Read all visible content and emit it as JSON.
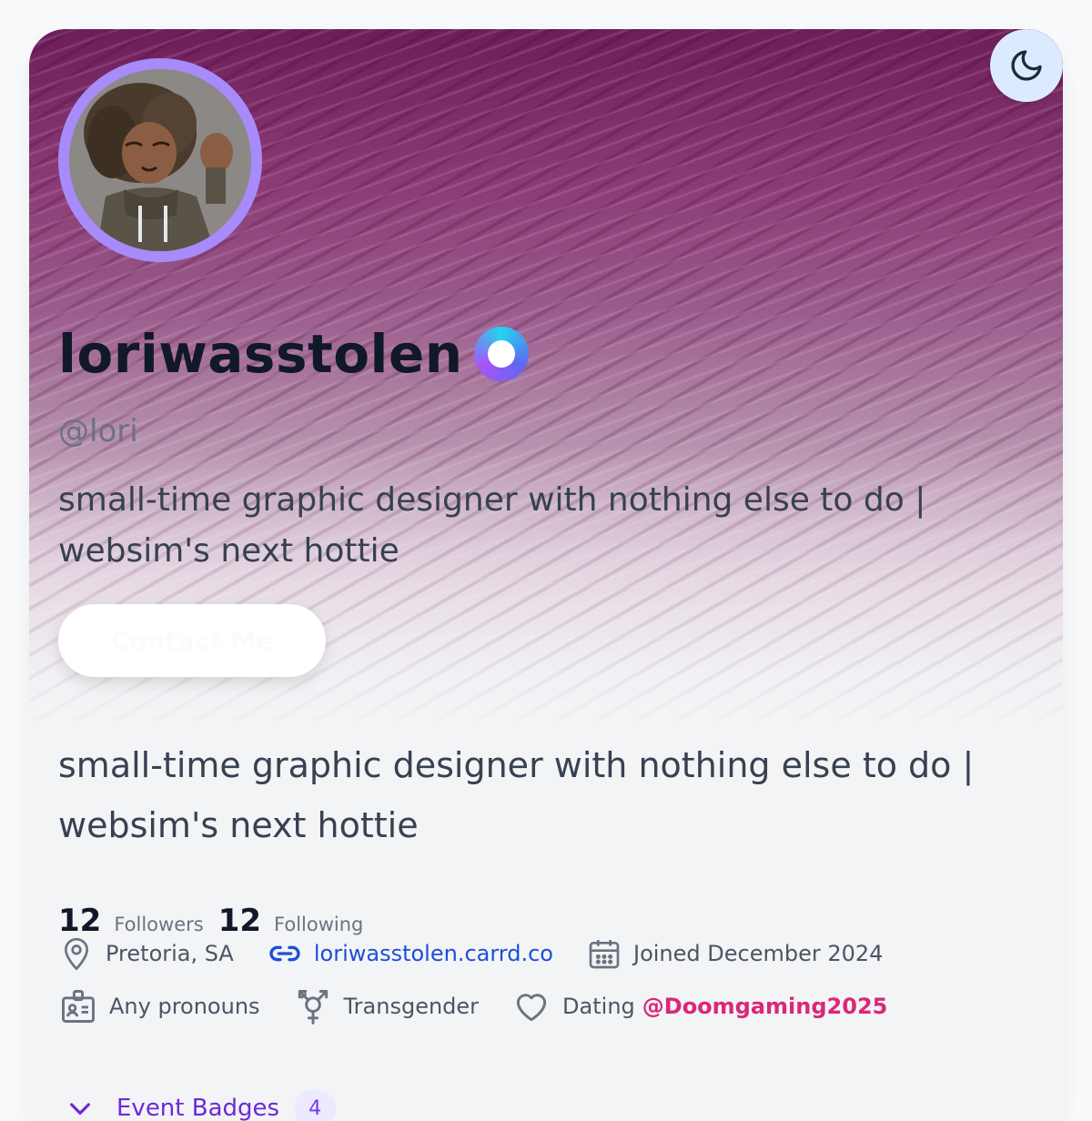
{
  "profile": {
    "display_name": "loriwasstolen",
    "handle": "@lori",
    "bio": "small-time graphic designer with nothing else to do | websim's next hottie",
    "contact_button_label": "Contact Me"
  },
  "stats": {
    "followers_count": "12",
    "followers_label": "Followers",
    "following_count": "12",
    "following_label": "Following"
  },
  "details": {
    "location": "Pretoria, SA",
    "website": "loriwasstolen.carrd.co",
    "joined": "Joined December 2024",
    "pronouns": "Any pronouns",
    "gender": "Transgender",
    "dating_label": "Dating",
    "dating_mention": "@Doomgaming2025"
  },
  "event_badges": {
    "label": "Event Badges",
    "count": "4"
  },
  "icons": [
    "moon-icon",
    "verified-icon",
    "location-pin-icon",
    "link-icon",
    "calendar-icon",
    "id-card-icon",
    "transgender-icon",
    "heart-icon",
    "chevron-down-icon"
  ],
  "colors": {
    "banner": "#6d1e59",
    "avatar_ring": "#a78bfa",
    "link": "#1d4ed8",
    "mention": "#db2777",
    "badge": "#6d28d9",
    "toggle_bg": "#dbeafe"
  }
}
